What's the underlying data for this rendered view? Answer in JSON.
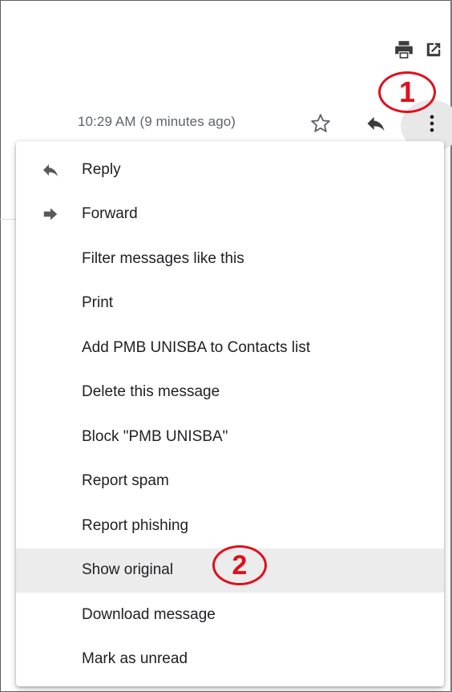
{
  "header": {
    "timestamp": "10:29 AM (9 minutes ago)",
    "icons": [
      "print-icon",
      "open-new-window-icon",
      "star-icon",
      "reply-icon",
      "more-vert-icon"
    ]
  },
  "annotations": {
    "first": "1",
    "second": "2",
    "color": "#e0101b"
  },
  "menu": {
    "items": [
      {
        "label": "Reply",
        "icon": "reply-icon"
      },
      {
        "label": "Forward",
        "icon": "forward-icon"
      },
      {
        "label": "Filter messages like this"
      },
      {
        "label": "Print"
      },
      {
        "label": "Add PMB UNISBA to Contacts list"
      },
      {
        "label": "Delete this message"
      },
      {
        "label": "Block \"PMB UNISBA\""
      },
      {
        "label": "Report spam"
      },
      {
        "label": "Report phishing"
      },
      {
        "label": "Show original",
        "highlighted": true
      },
      {
        "label": "Download message"
      },
      {
        "label": "Mark as unread"
      }
    ]
  }
}
